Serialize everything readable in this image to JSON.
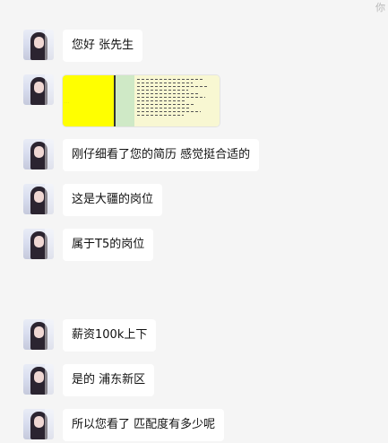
{
  "corner": {
    "text": "你"
  },
  "messages": [
    {
      "text": "您好 张先生"
    },
    {
      "text": ""
    },
    {
      "text": "刚仔细看了您的简历 感觉挺合适的"
    },
    {
      "text": "这是大疆的岗位"
    },
    {
      "text": "属于T5的岗位"
    },
    {
      "text": "薪资100k上下"
    },
    {
      "text": "是的 浦东新区"
    },
    {
      "text": "所以您看了 匹配度有多少呢"
    }
  ],
  "colors": {
    "background": "#f5f5f5",
    "bubble": "#ffffff",
    "image_yellow": "#ffff00",
    "image_green": "#cfe9c6",
    "image_doc": "#f8f7d2"
  }
}
